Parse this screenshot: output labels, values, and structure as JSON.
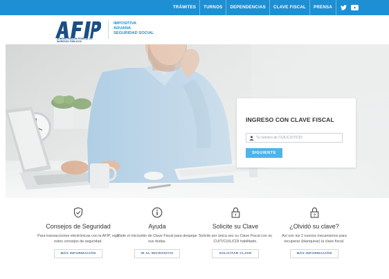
{
  "topnav": {
    "items": [
      "TRÁMITES",
      "TURNOS",
      "DEPENDENCIAS",
      "CLAVE FISCAL",
      "PRENSA"
    ],
    "social": [
      "twitter-icon",
      "youtube-icon"
    ]
  },
  "header": {
    "logo_caption": "ADMINISTRACIÓN FEDERAL DE INGRESOS PÚBLICOS",
    "org_lines": [
      "IMPOSITIVA",
      "ADUANA",
      "SEGURIDAD SOCIAL"
    ]
  },
  "login": {
    "title": "INGRESO CON CLAVE FISCAL",
    "placeholder": "Tu número de CUIL/CUIT/CDI",
    "button": "SIGUIENTE"
  },
  "features": [
    {
      "icon": "shield-check-icon",
      "title": "Consejos de Seguridad",
      "desc": "Para transacciones electrónicas con la AFIP, sigá estos consejos de seguridad.",
      "button": "MÁS INFORMACIÓN"
    },
    {
      "icon": "info-icon",
      "title": "Ayuda",
      "desc": "Visite el micrositio de Clave Fiscal para despejar sus dudas.",
      "button": "IR AL MICROSITIO"
    },
    {
      "icon": "lock-icon",
      "title": "Solicite su Clave",
      "desc": "Solicite por única vez su Clave Fiscal con su CUIT/CUIL/CDI habilitado.",
      "button": "SOLICITAR CLAVE"
    },
    {
      "icon": "lock-question-icon",
      "title": "¿Olvidó su clave?",
      "desc": "Así son los 2 nuevos mecanismos para recuperar (blanquear) la clave fiscal.",
      "button": "MÁS INFORMACIÓN"
    }
  ],
  "colors": {
    "brand_blue": "#1e8fd3",
    "button_blue": "#4fb3e8",
    "logo_navy": "#1a4f86"
  }
}
